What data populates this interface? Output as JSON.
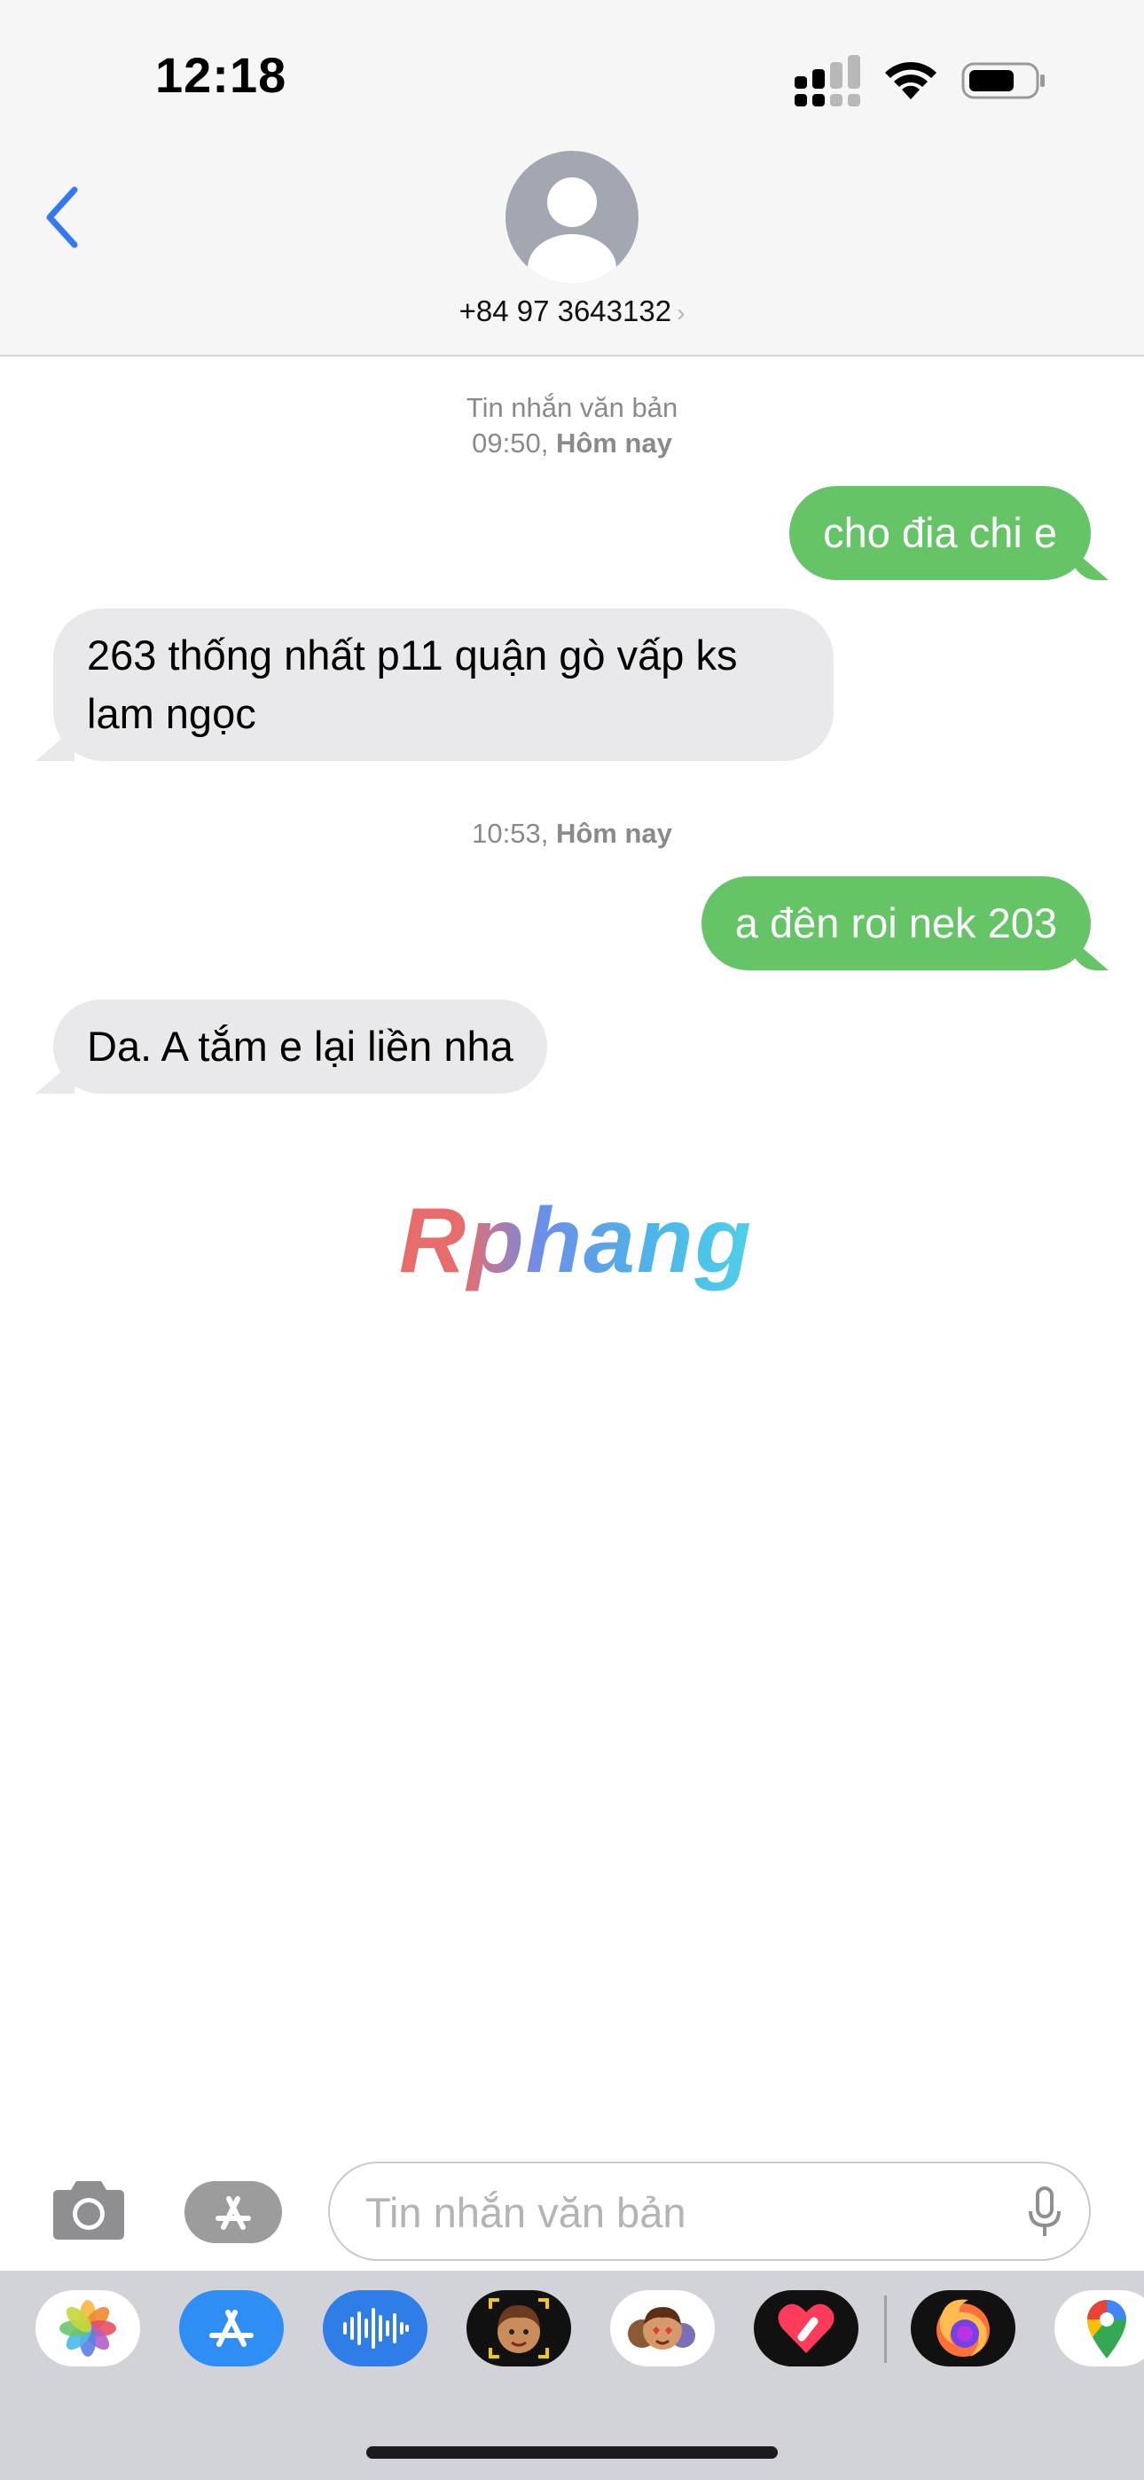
{
  "status_bar": {
    "time": "12:18"
  },
  "header": {
    "contact": "+84 97 3643132",
    "chevron": "›"
  },
  "messages": {
    "stamp1_label": "Tin nhắn văn bản",
    "stamp1_time": "09:50,",
    "stamp1_day": "Hôm nay",
    "m1": "cho đia chi e",
    "m2": "263 thống nhất p11 quận gò vấp ks lam ngọc",
    "stamp2_time": "10:53,",
    "stamp2_day": "Hôm nay",
    "m3": "a đên roi nek 203",
    "m4": "Da. A tắm e lại liền nha"
  },
  "watermark": "Rphang",
  "input": {
    "placeholder": "Tin nhắn văn bản",
    "value": ""
  },
  "drawer": {
    "apps": [
      "photos-icon",
      "app-store-icon",
      "audio-message-icon",
      "memoji-icon",
      "memoji-stickers-icon",
      "digital-touch-icon",
      "firefox-icon",
      "google-maps-icon"
    ]
  },
  "colors": {
    "sent_bubble": "#65c466",
    "received_bubble": "#e9e9eb",
    "accent": "#3478f6"
  }
}
